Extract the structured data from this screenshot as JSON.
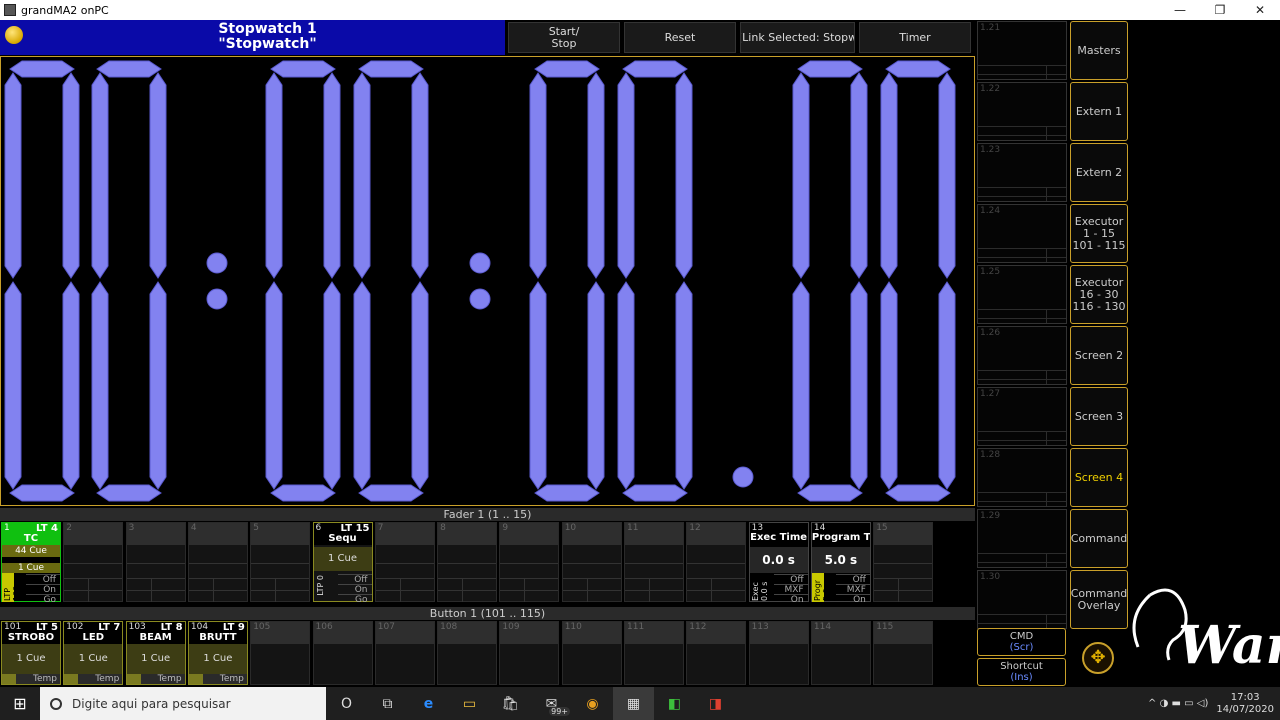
{
  "window": {
    "title": "grandMA2 onPC",
    "minimize": "—",
    "maximize": "❐",
    "close": "✕"
  },
  "header": {
    "title_line1": "Stopwatch 1",
    "title_line2": "\"Stopwatch\"",
    "buttons": [
      "Start/\nStop",
      "Reset",
      "[Link Selected: Stopw",
      "Timer"
    ]
  },
  "stopwatch": {
    "value": "00:00:00.0",
    "segment_color": "#8282f0"
  },
  "right_slots": [
    "1.21",
    "1.22",
    "1.23",
    "1.24",
    "1.25",
    "1.26",
    "1.27",
    "1.28",
    "1.29",
    "1.30"
  ],
  "view_buttons": [
    {
      "label": "Masters",
      "active": false
    },
    {
      "label": "Extern 1",
      "active": false
    },
    {
      "label": "Extern 2",
      "active": false
    },
    {
      "label": "Executor\n1 - 15\n101 - 115",
      "active": false
    },
    {
      "label": "Executor\n16 - 30\n116 - 130",
      "active": false
    },
    {
      "label": "Screen 2",
      "active": false
    },
    {
      "label": "Screen 3",
      "active": false
    },
    {
      "label": "Screen 4",
      "active": true
    },
    {
      "label": "Command",
      "active": false
    },
    {
      "label": "Command\nOverlay",
      "active": false
    }
  ],
  "cmd": {
    "label": "CMD",
    "sub": "(Scr)"
  },
  "shortcut": {
    "label": "Shortcut",
    "sub": "(Ins)"
  },
  "move_icon": "✥",
  "fader_section": "Fader  1 (1 .. 15)",
  "button_section": "Button  1 (101 .. 115)",
  "faders": {
    "f1": {
      "num": "1",
      "type": "LT",
      "tnum": "4",
      "name": "TC",
      "cues": "44 Cue",
      "cue": "1 Cue",
      "vlabel": "LTP 100",
      "opts": [
        "Off",
        "On",
        "Go"
      ]
    },
    "f6": {
      "num": "6",
      "type": "LT",
      "tnum": "15",
      "name": "Sequ",
      "cue": "1 Cue",
      "vlabel": "LTP 0",
      "opts": [
        "Off",
        "On",
        "Go"
      ]
    },
    "f13": {
      "num": "13",
      "name": "Exec Time",
      "value": "0.0 s",
      "vlabel": "Exec 0.0 s",
      "opts": [
        "Off",
        "MXF",
        "On"
      ]
    },
    "f14": {
      "num": "14",
      "name": "Program T",
      "value": "5.0 s",
      "vlabel": "Progr 5.0 s",
      "opts": [
        "Off",
        "MXF",
        "On"
      ]
    },
    "empty_numbers": [
      "2",
      "3",
      "4",
      "5",
      "7",
      "8",
      "9",
      "10",
      "11",
      "12",
      "15"
    ]
  },
  "buttons": {
    "active": [
      {
        "num": "101",
        "type": "LT",
        "tnum": "5",
        "name": "STROBO",
        "cue": "1 Cue",
        "tmp": "Temp"
      },
      {
        "num": "102",
        "type": "LT",
        "tnum": "7",
        "name": "LED",
        "cue": "1 Cue",
        "tmp": "Temp"
      },
      {
        "num": "103",
        "type": "LT",
        "tnum": "8",
        "name": "BEAM",
        "cue": "1 Cue",
        "tmp": "Temp"
      },
      {
        "num": "104",
        "type": "LT",
        "tnum": "9",
        "name": "BRUTT",
        "cue": "1 Cue",
        "tmp": "Temp"
      }
    ],
    "empty_numbers": [
      "105",
      "106",
      "107",
      "108",
      "109",
      "110",
      "111",
      "112",
      "113",
      "114",
      "115"
    ]
  },
  "taskbar": {
    "search_placeholder": "Digite aqui para pesquisar",
    "icons": [
      "O",
      "⧉",
      "e",
      "▭",
      "🛍",
      "✉",
      "◉",
      "▦",
      "◧",
      "◨"
    ],
    "badge": "99+",
    "tray": "^  ◑  ▬  ▭  ◁)",
    "time": "17:03",
    "date": "14/07/2020"
  },
  "logo": "Wan"
}
